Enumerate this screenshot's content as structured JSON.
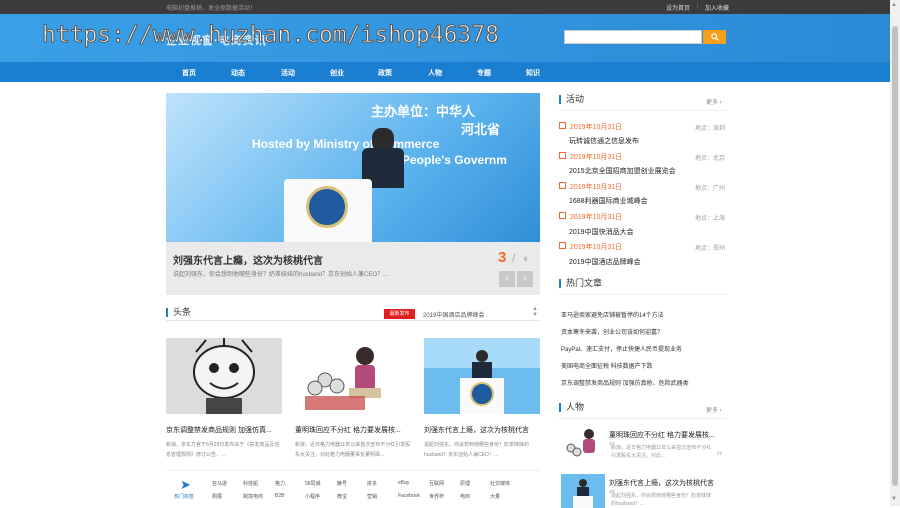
{
  "topbar": {
    "tip": "电脑初盘推销，发全原数据活动！",
    "links": [
      "设为首页",
      "加入收藏"
    ],
    "separator": "|"
  },
  "header": {
    "logo_text": "企业视窗·电商资讯",
    "watermark": "https://www.huzhan.com/ishop46378",
    "search_placeholder": "",
    "search_icon": "search-icon"
  },
  "nav": {
    "items": [
      "首页",
      "动态",
      "活动",
      "创业",
      "政策",
      "人物",
      "专题",
      "知识"
    ]
  },
  "hero": {
    "banner_texts": [
      "主办单位：中华人",
      "河北省",
      "Hosted by Ministry of Commerce",
      "People's Governm"
    ],
    "title": "刘强东代言上瘾，这次为核桃代言",
    "desc": "说起刘强东，你会想到他哪些身份？奶茶妹妹的husband？京东创始人兼CEO？...",
    "page_current": "3",
    "page_sep": "/",
    "page_total": "6",
    "prev": "‹",
    "next": "›"
  },
  "headlines": {
    "title": "头条",
    "new_badge": "最新发布",
    "ticker": "2019中国酒店品牌峰会",
    "cards": [
      {
        "title": "京东调整禁发商品规则 加强仿真...",
        "desc": "新浪，京东方官于6月28日发布关于《禁发商品及信息管理规则》修订公告，..."
      },
      {
        "title": "董明珠回应不分红 格力要发展核...",
        "desc": "新浪，近日格力电器11年以来首次宣布不分红引发股东大关注，对此格力电器董事长董明珠..."
      },
      {
        "title": "刘强东代言上瘾，这次为核桃代言",
        "desc": "说起刘强东，你会想到他哪些身份？奶茶妹妹的husband？京东创始人兼CEO！..."
      }
    ]
  },
  "tags": {
    "label": "热门标签",
    "row1": [
      "亚马逊",
      "科技船",
      "格力",
      "58同城",
      "魅号",
      "拼多",
      "eBay",
      "互联网",
      "原理",
      "社交媒体"
    ],
    "row2": [
      "刚展",
      "跨境电商",
      "B2B",
      "小程序",
      "微宝",
      "营销",
      "Facebook",
      "世界杯",
      "电商",
      "大量"
    ]
  },
  "activity": {
    "title": "活动",
    "more": "更多 ›",
    "loc_prefix": "地点：",
    "events": [
      {
        "date": "2019年10月31日",
        "loc": "深圳",
        "title": "玩转诚信通之信息发布"
      },
      {
        "date": "2019年10月31日",
        "loc": "北京",
        "title": "2015北京全国招商加盟创业展览会"
      },
      {
        "date": "2019年10月31日",
        "loc": "广州",
        "title": "1688利器国际商业城峰会"
      },
      {
        "date": "2019年10月31日",
        "loc": "上海",
        "title": "2019中国快消品大会"
      },
      {
        "date": "2019年10月31日",
        "loc": "郑州",
        "title": "2019中国酒店品牌峰会"
      }
    ]
  },
  "hot": {
    "title": "热门文章",
    "items": [
      "亚马逊卖家避免店铺被暂停的14个方法",
      "资本寒冬来袭，创业公司该如何迎嘉？",
      "PayPal、速汇支付，停止快捷人民币提现业务",
      "美国电商全面征税 科技数据产下跌",
      "京东调整禁发商品规则 加强仿真枪、危险武器类"
    ]
  },
  "people": {
    "title": "人物",
    "more": "更多 ›",
    "items": [
      {
        "title": "董明珠回应不分红 格力要发展核...",
        "desc": "新浪，近日格力电器11年以来首次宣布不分红引发股东大关注，对此..."
      },
      {
        "title": "刘强东代言上瘾，这次为核桃代言",
        "desc": "说起刘强东，你会想到他哪些身份？奶茶妹妹的husband？..."
      }
    ],
    "quote_open": "“",
    "quote_close": "”"
  }
}
